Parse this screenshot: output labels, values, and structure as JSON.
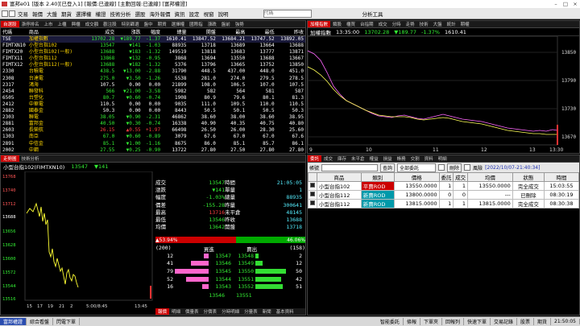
{
  "window": {
    "title": "富邦e01 [版本 2.40][已登入1] [報價:已連線] [主動回報:已連線] [富邦權證]"
  },
  "menu": {
    "items": [
      "交易",
      "報價",
      "大盤",
      "期貨",
      "選擇權",
      "權證",
      "技術分析",
      "選股",
      "海外報價",
      "資訊",
      "設定",
      "視窗",
      "說明"
    ],
    "search_placeholder": "代碼",
    "right_label": "分析工具"
  },
  "quote": {
    "tabs": [
      "自選股",
      "漲停排名",
      "上市",
      "上櫃",
      "興櫃",
      "成交額",
      "觀注股",
      "特別篩選",
      "盤中",
      "期貨",
      "選擇權",
      "國際指",
      "漲跌",
      "盤前",
      "強勢"
    ],
    "headers": [
      "代碼",
      "商品",
      "成交",
      "漲跌",
      "幅度",
      "總量",
      "開盤",
      "最高",
      "最低",
      "昨收"
    ],
    "rows": [
      {
        "code": "TSE",
        "name": "加權指數",
        "price": "13702.28",
        "chg": "▼189.77",
        "pct": "-1.37",
        "vol": "1610.41",
        "open": "13847.52",
        "high": "13684.21",
        "low": "13747.52",
        "prev": "13892.05",
        "dir": "dn"
      },
      {
        "code": "FIMTXN10",
        "name": "小型台指102",
        "price": "13547",
        "chg": "▼141",
        "pct": "-1.03",
        "vol": "88935",
        "open": "13718",
        "high": "13689",
        "low": "13664",
        "prev": "13688",
        "dir": "dn"
      },
      {
        "code": "FIMTX20",
        "name": "小型台指102(一般)",
        "price": "13688",
        "chg": "▼183",
        "pct": "-1.32",
        "vol": "149519",
        "open": "13818",
        "high": "13683",
        "low": "13777",
        "prev": "13871",
        "dir": "dn"
      },
      {
        "code": "FIMTX11",
        "name": "小型台指112",
        "price": "13868",
        "chg": "▼132",
        "pct": "-0.95",
        "vol": "3868",
        "open": "13694",
        "high": "13550",
        "low": "13688",
        "prev": "13667",
        "dir": "dn"
      },
      {
        "code": "FIMTX12",
        "name": "小型台指112(一般)",
        "price": "13688",
        "chg": "▼182",
        "pct": "-1.32",
        "vol": "5376",
        "open": "13796",
        "high": "13665",
        "low": "13752",
        "prev": "13850",
        "dir": "dn"
      },
      {
        "code": "2330",
        "name": "台積電",
        "price": "438.5",
        "chg": "▼13.00",
        "pct": "-2.88",
        "vol": "31790",
        "open": "448.5",
        "high": "437.00",
        "low": "448.0",
        "prev": "451.0",
        "dir": "dn"
      },
      {
        "code": "2308",
        "name": "台達電",
        "price": "275.0",
        "chg": "▼3.50",
        "pct": "-1.26",
        "vol": "5538",
        "open": "281.0",
        "high": "274.0",
        "low": "279.5",
        "prev": "278.5",
        "dir": "dn"
      },
      {
        "code": "2317",
        "name": "鴻海",
        "price": "107.5",
        "chg": "0.00",
        "pct": "0.00",
        "vol": "21899",
        "open": "108.0",
        "high": "106.5",
        "low": "107.0",
        "prev": "107.5",
        "dir": "wh"
      },
      {
        "code": "2454",
        "name": "聯發科",
        "price": "566",
        "chg": "▼21.00",
        "pct": "-3.58",
        "vol": "5982",
        "open": "582",
        "high": "564",
        "low": "581",
        "prev": "587",
        "dir": "dn"
      },
      {
        "code": "6505",
        "name": "台塑化",
        "price": "80.7",
        "chg": "▼0.60",
        "pct": "-0.74",
        "vol": "1908",
        "open": "80.9",
        "high": "79.6",
        "low": "80.1",
        "prev": "81.3",
        "dir": "dn"
      },
      {
        "code": "2412",
        "name": "中華電",
        "price": "110.5",
        "chg": "0.00",
        "pct": "0.00",
        "vol": "9035",
        "open": "111.0",
        "high": "109.5",
        "low": "110.0",
        "prev": "110.5",
        "dir": "wh"
      },
      {
        "code": "2882",
        "name": "國泰金",
        "price": "50.3",
        "chg": "0.00",
        "pct": "0.00",
        "vol": "8443",
        "open": "50.5",
        "high": "50.1",
        "low": "50.5",
        "prev": "50.3",
        "dir": "wh"
      },
      {
        "code": "2303",
        "name": "聯電",
        "price": "38.05",
        "chg": "▼0.90",
        "pct": "-2.31",
        "vol": "46862",
        "open": "38.60",
        "high": "38.00",
        "low": "38.60",
        "prev": "38.95",
        "dir": "dn"
      },
      {
        "code": "2881",
        "name": "富邦金",
        "price": "40.50",
        "chg": "▼0.30",
        "pct": "-0.74",
        "vol": "16338",
        "open": "40.90",
        "high": "40.35",
        "low": "40.75",
        "prev": "40.80",
        "dir": "dn"
      },
      {
        "code": "2603",
        "name": "長榮航",
        "price": "26.15",
        "chg": "▲0.55",
        "pct": "+1.97",
        "vol": "66498",
        "open": "26.50",
        "high": "26.00",
        "low": "28.30",
        "prev": "25.60",
        "dir": "up"
      },
      {
        "code": "1303",
        "name": "南亞",
        "price": "67.0",
        "chg": "▼0.60",
        "pct": "-0.89",
        "vol": "3079",
        "open": "67.6",
        "high": "67.0",
        "low": "67.0",
        "prev": "67.6",
        "dir": "dn"
      },
      {
        "code": "2891",
        "name": "中信金",
        "price": "85.1",
        "chg": "▼1.00",
        "pct": "-1.16",
        "vol": "8675",
        "open": "86.0",
        "high": "85.1",
        "low": "85.7",
        "prev": "86.1",
        "dir": "dn"
      },
      {
        "code": "2002",
        "name": "中鋼",
        "price": "27.55",
        "chg": "▼0.25",
        "pct": "-0.90",
        "vol": "13722",
        "open": "27.80",
        "high": "27.50",
        "low": "27.80",
        "prev": "27.80",
        "dir": "dn"
      }
    ]
  },
  "index_chart": {
    "tabs": [
      "加權指數",
      "類股",
      "櫃買",
      "台指期",
      "成交",
      "分時",
      "走勢",
      "技術",
      "大盤",
      "統計",
      "期權"
    ],
    "name": "加權指數",
    "time": "13:35:00",
    "price": "13702.28",
    "chg": "▼189.77",
    "pct": "-1.37%",
    "vol": "1610.41",
    "y_ticks": [
      "13850",
      "13790",
      "13730",
      "13670"
    ],
    "x_ticks": [
      "9",
      "10",
      "11",
      "12",
      "13",
      "13:30"
    ]
  },
  "detail": {
    "tabs": [
      "走勢圖",
      "技術分析"
    ],
    "symbol": "小型台指102(FIMTXN10)",
    "price": "13547",
    "chg": "▼141",
    "time": "21:05:05",
    "y_ticks": [
      "13768",
      "13740",
      "13712",
      "13688",
      "13656",
      "13628",
      "13600",
      "13572",
      "13544",
      "13516"
    ],
    "x_ticks": [
      "15",
      "17",
      "19",
      "21",
      "2",
      "5:00/8:45",
      "13:45"
    ],
    "info": [
      {
        "l": "成交",
        "v": "13547",
        "l2": "時間",
        "v2": "21:05:05",
        "c": "dn"
      },
      {
        "l": "漲跌",
        "v": "▼141",
        "l2": "單量",
        "v2": "1",
        "c": "dn"
      },
      {
        "l": "幅度",
        "v": "-1.03%",
        "l2": "總量",
        "v2": "88935",
        "c": "dn"
      },
      {
        "l": "價差",
        "v": "-155.28",
        "l2": "昨量",
        "v2": "300641",
        "c": "dn"
      },
      {
        "l": "最高",
        "v": "13716",
        "l2": "未平倉",
        "v2": "48145",
        "c": "up"
      },
      {
        "l": "最低",
        "v": "13546",
        "l2": "昨收",
        "v2": "13688",
        "c": "dn"
      },
      {
        "l": "均價",
        "v": "13642",
        "l2": "開盤",
        "v2": "13718",
        "c": "dn"
      }
    ],
    "buy_pct": "▲53.94%",
    "sell_pct": "46.06%",
    "depth_left": "(200)",
    "depth_right": "(158)",
    "depth_header_buy": "買進",
    "depth_header_sell": "賣出",
    "depth": [
      {
        "bq": "12",
        "bp": "13547",
        "sp": "13548",
        "sq": "2",
        "bw": 0.15,
        "sw": 0.1
      },
      {
        "bq": "41",
        "bp": "13546",
        "sp": "13549",
        "sq": "12",
        "bw": 0.52,
        "sw": 0.24
      },
      {
        "bq": "79",
        "bp": "13545",
        "sp": "13550",
        "sq": "50",
        "bw": 1.0,
        "sw": 1.0
      },
      {
        "bq": "52",
        "bp": "13544",
        "sp": "13551",
        "sq": "42",
        "bw": 0.66,
        "sw": 0.84
      },
      {
        "bq": "16",
        "bp": "13543",
        "sp": "13552",
        "sq": "51",
        "bw": 0.2,
        "sw": 0.9
      }
    ],
    "depth_total_buy": "13546",
    "depth_total_sell": "13551",
    "bottom_tabs": [
      "報價",
      "明細",
      "價量表",
      "分價表",
      "分時明細",
      "分量表",
      "新聞",
      "基本資料"
    ]
  },
  "orders": {
    "tabs": [
      "委託",
      "成交",
      "庫存",
      "未平倉",
      "權益",
      "損益",
      "帳務",
      "交割",
      "資料",
      "明細"
    ],
    "account_label": "帳號",
    "search_label": "查詢",
    "filter_label": "全部委託",
    "delete_label": "刪除",
    "flag_label": "風險",
    "date": "[2022/10/07-21:40:34]",
    "headers": [
      "",
      "商品",
      "類別",
      "價格",
      "委託",
      "成交",
      "均價",
      "狀態",
      "時間"
    ],
    "rows": [
      {
        "product": "小型台指102",
        "type": "平賣ROD",
        "price": "13550.0000",
        "qty": "1",
        "fill": "1",
        "avg": "13550.0000",
        "status": "完全成交",
        "time": "15:03:55",
        "tc": "#c00"
      },
      {
        "product": "小型台指112",
        "type": "新賣ROD",
        "price": "13800.0000",
        "qty": "0",
        "fill": "0",
        "avg": "---",
        "status": "已刪除",
        "time": "08:30:19",
        "tc": "#09a"
      },
      {
        "product": "小型台指112",
        "type": "新賣ROD",
        "price": "13815.0000",
        "qty": "1",
        "fill": "1",
        "avg": "13815.0000",
        "status": "完全成交",
        "time": "08:30:38",
        "tc": "#09a"
      }
    ]
  },
  "statusbar": {
    "left": [
      "富邦權證",
      "綜合看盤",
      "閃電下單"
    ],
    "right": [
      "智能委託",
      "條報",
      "下單夾",
      "回報列",
      "快速下單",
      "交易記錄",
      "股票",
      "期貨",
      "21:50:05"
    ]
  }
}
